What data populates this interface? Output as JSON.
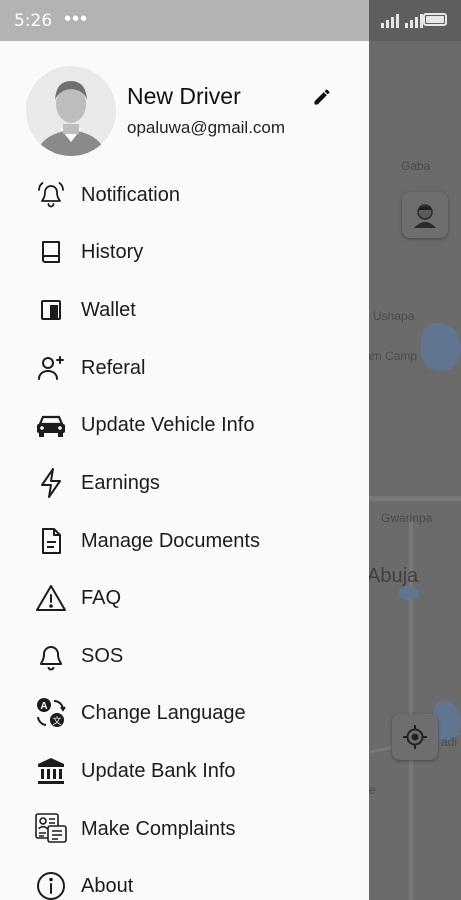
{
  "status_bar": {
    "time": "5:26",
    "dots": "•••",
    "battery_icon": "battery-icon",
    "signal_icon": "signal-icon"
  },
  "profile": {
    "name": "New Driver",
    "email": "opaluwa@gmail.com",
    "avatar_icon": "person-avatar-icon",
    "edit_icon": "pencil-icon"
  },
  "menu": [
    {
      "label": "Notification",
      "icon": "bell-ringing-icon"
    },
    {
      "label": "History",
      "icon": "book-icon"
    },
    {
      "label": "Wallet",
      "icon": "wallet-icon"
    },
    {
      "label": "Referal",
      "icon": "person-add-icon"
    },
    {
      "label": "Update Vehicle Info",
      "icon": "car-icon"
    },
    {
      "label": "Earnings",
      "icon": "lightning-icon"
    },
    {
      "label": "Manage Documents",
      "icon": "document-icon"
    },
    {
      "label": "FAQ",
      "icon": "warning-icon"
    },
    {
      "label": "SOS",
      "icon": "bell-icon"
    },
    {
      "label": "Change Language",
      "icon": "translate-icon"
    },
    {
      "label": "Update Bank Info",
      "icon": "bank-icon"
    },
    {
      "label": "Make Complaints",
      "icon": "complaint-icon"
    },
    {
      "label": "About",
      "icon": "info-icon"
    }
  ],
  "map": {
    "labels": [
      "Gaba",
      "Ushapa",
      "am Camp",
      "Gwarinpa",
      "Abuja",
      "adi",
      "e"
    ],
    "profile_fab_icon": "driver-profile-icon",
    "location_fab_icon": "my-location-icon"
  }
}
